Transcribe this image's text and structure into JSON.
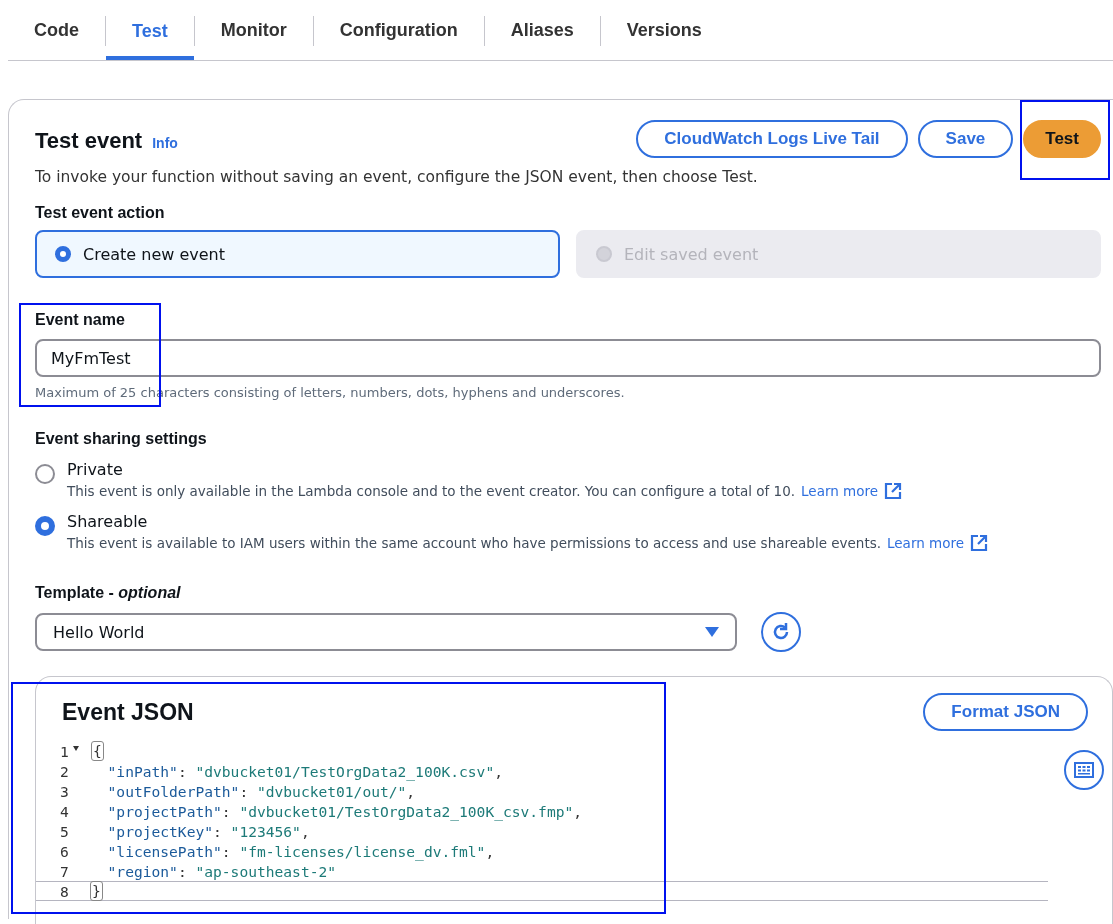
{
  "tabs": [
    {
      "label": "Code",
      "selected": false
    },
    {
      "label": "Test",
      "selected": true
    },
    {
      "label": "Monitor",
      "selected": false
    },
    {
      "label": "Configuration",
      "selected": false
    },
    {
      "label": "Aliases",
      "selected": false
    },
    {
      "label": "Versions",
      "selected": false
    }
  ],
  "test_event": {
    "title": "Test event",
    "info_link": "Info",
    "buttons": [
      {
        "label": "CloudWatch Logs Live Tail",
        "kind": "secondary",
        "highlighted": false
      },
      {
        "label": "Save",
        "kind": "secondary",
        "highlighted": false
      },
      {
        "label": "Test",
        "kind": "primary",
        "highlighted": true
      }
    ],
    "description": "To invoke your function without saving an event, configure the JSON event, then choose Test.",
    "action": {
      "label": "Test event action",
      "options": [
        {
          "label": "Create new event",
          "selected": true,
          "disabled": false
        },
        {
          "label": "Edit saved event",
          "selected": false,
          "disabled": true
        }
      ]
    },
    "event_name": {
      "label": "Event name",
      "value": "MyFmTest",
      "hint": "Maximum of 25 characters consisting of letters, numbers, dots, hyphens and underscores.",
      "highlighted": true
    },
    "sharing": {
      "label": "Event sharing settings",
      "options": [
        {
          "label": "Private",
          "selected": false,
          "description": "This event is only available in the Lambda console and to the event creator. You can configure a total of 10.",
          "link": "Learn more"
        },
        {
          "label": "Shareable",
          "selected": true,
          "description": "This event is available to IAM users within the same account who have permissions to access and use shareable events.",
          "link": "Learn more"
        }
      ]
    },
    "template": {
      "label": "Template - *optional*",
      "value": "Hello World"
    },
    "event_json": {
      "title": "Event JSON",
      "button": "Format JSON",
      "highlighted": true,
      "lines": [
        {
          "number": "1",
          "text": "{",
          "foldable": true,
          "bracket_match": true,
          "current": false
        },
        {
          "number": "2",
          "text": "  \"inPath\": \"dvbucket01/TestOrgData2_100K.csv\",",
          "foldable": false,
          "bracket_match": false,
          "current": false
        },
        {
          "number": "3",
          "text": "  \"outFolderPath\": \"dvbucket01/out/\",",
          "foldable": false,
          "bracket_match": false,
          "current": false
        },
        {
          "number": "4",
          "text": "  \"projectPath\": \"dvbucket01/TestOrgData2_100K_csv.fmp\",",
          "foldable": false,
          "bracket_match": false,
          "current": false
        },
        {
          "number": "5",
          "text": "  \"projectKey\": \"123456\",",
          "foldable": false,
          "bracket_match": false,
          "current": false
        },
        {
          "number": "6",
          "text": "  \"licensePath\": \"fm-licenses/license_dv.fml\",",
          "foldable": false,
          "bracket_match": false,
          "current": false
        },
        {
          "number": "7",
          "text": "  \"region\": \"ap-southeast-2\"",
          "foldable": false,
          "bracket_match": false,
          "current": false
        },
        {
          "number": "8",
          "text": "}",
          "foldable": false,
          "bracket_match": true,
          "current": true
        }
      ]
    }
  }
}
